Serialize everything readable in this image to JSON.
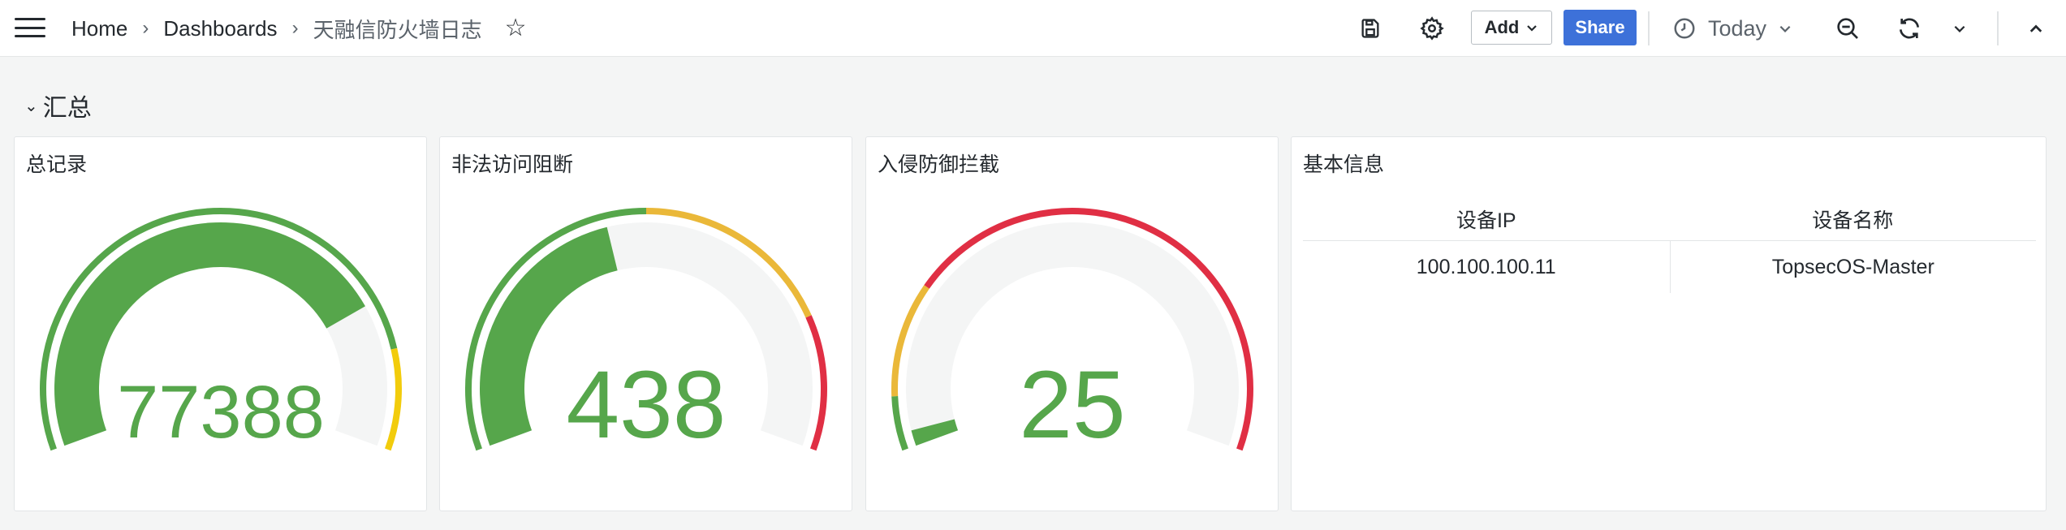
{
  "breadcrumb": {
    "home": "Home",
    "dashboards": "Dashboards",
    "current": "天融信防火墙日志"
  },
  "toolbar": {
    "add_label": "Add",
    "share_label": "Share",
    "time_range": "Today"
  },
  "row": {
    "title": "汇总"
  },
  "panels": [
    {
      "title": "总记录",
      "value": "77388",
      "min": 0,
      "max": 100000,
      "current": 77388,
      "thresholds": [
        {
          "from": 0,
          "to": 85000,
          "color": "#56a64b"
        },
        {
          "from": 85000,
          "to": 100000,
          "color": "#f2cc0c"
        }
      ]
    },
    {
      "title": "非法访问阻断",
      "value": "438",
      "min": 0,
      "max": 1000,
      "current": 438,
      "thresholds": [
        {
          "from": 0,
          "to": 500,
          "color": "#56a64b"
        },
        {
          "from": 500,
          "to": 800,
          "color": "#eab839"
        },
        {
          "from": 800,
          "to": 1000,
          "color": "#e02f44"
        }
      ]
    },
    {
      "title": "入侵防御拦截",
      "value": "25",
      "min": 0,
      "max": 1000,
      "current": 25,
      "thresholds": [
        {
          "from": 0,
          "to": 80,
          "color": "#56a64b"
        },
        {
          "from": 80,
          "to": 250,
          "color": "#eab839"
        },
        {
          "from": 250,
          "to": 1000,
          "color": "#e02f44"
        }
      ]
    }
  ],
  "info_panel": {
    "title": "基本信息",
    "columns": [
      "设备IP",
      "设备名称"
    ],
    "rows": [
      [
        "100.100.100.11",
        "TopsecOS-Master"
      ]
    ]
  },
  "colors": {
    "value_text": "#56a64b",
    "track": "#f4f5f5",
    "share": "#3d71d9"
  }
}
